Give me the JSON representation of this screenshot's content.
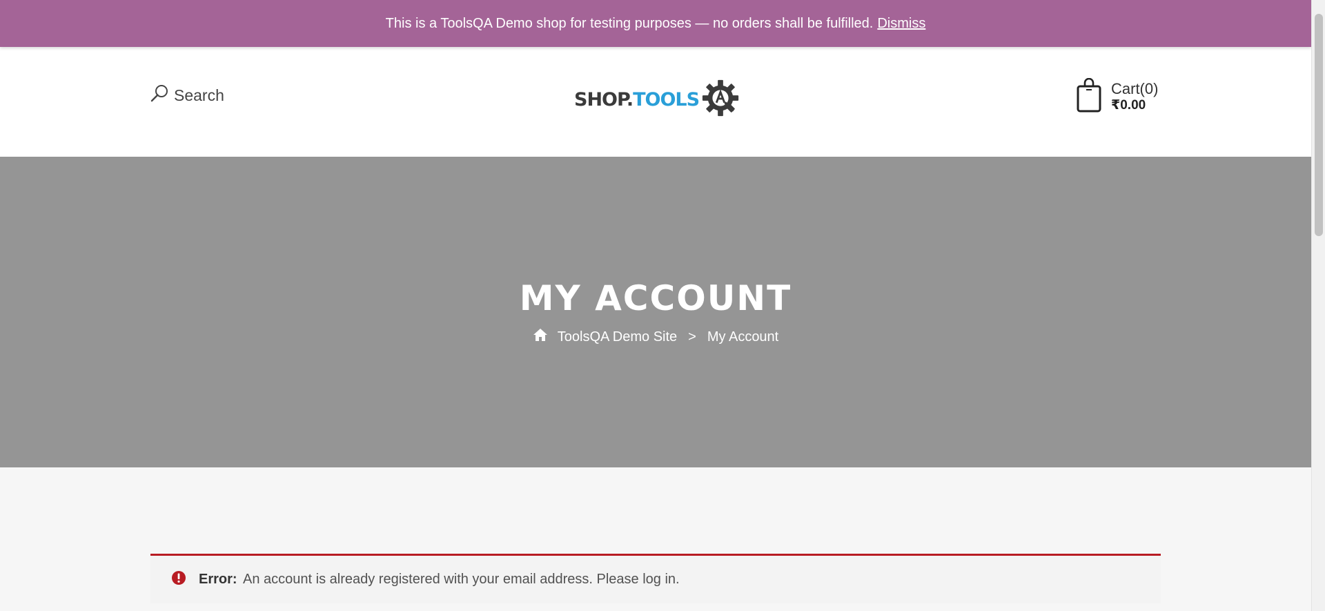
{
  "notice": {
    "text": "This is a ToolsQA Demo shop for testing purposes — no orders shall be fulfilled.",
    "dismiss_label": "Dismiss",
    "background": "#a46497"
  },
  "header": {
    "search_label": "Search",
    "logo": {
      "part1": "SHOP.",
      "part2": "TOOLS",
      "gear_letter": "A"
    },
    "cart": {
      "label": "Cart(0)",
      "total": "₹0.00"
    }
  },
  "hero": {
    "title": "MY ACCOUNT",
    "breadcrumb": {
      "home": "ToolsQA Demo Site",
      "separator": ">",
      "current": "My Account"
    },
    "background": "#959595"
  },
  "error": {
    "label": "Error:",
    "message": "An account is already registered with your email address. Please log in.",
    "accent": "#b81c23"
  },
  "icons": {
    "search": "search-icon",
    "cart": "shopping-bag-icon",
    "home": "home-icon",
    "error": "exclamation-circle-icon",
    "logo_gear": "gear-icon"
  }
}
